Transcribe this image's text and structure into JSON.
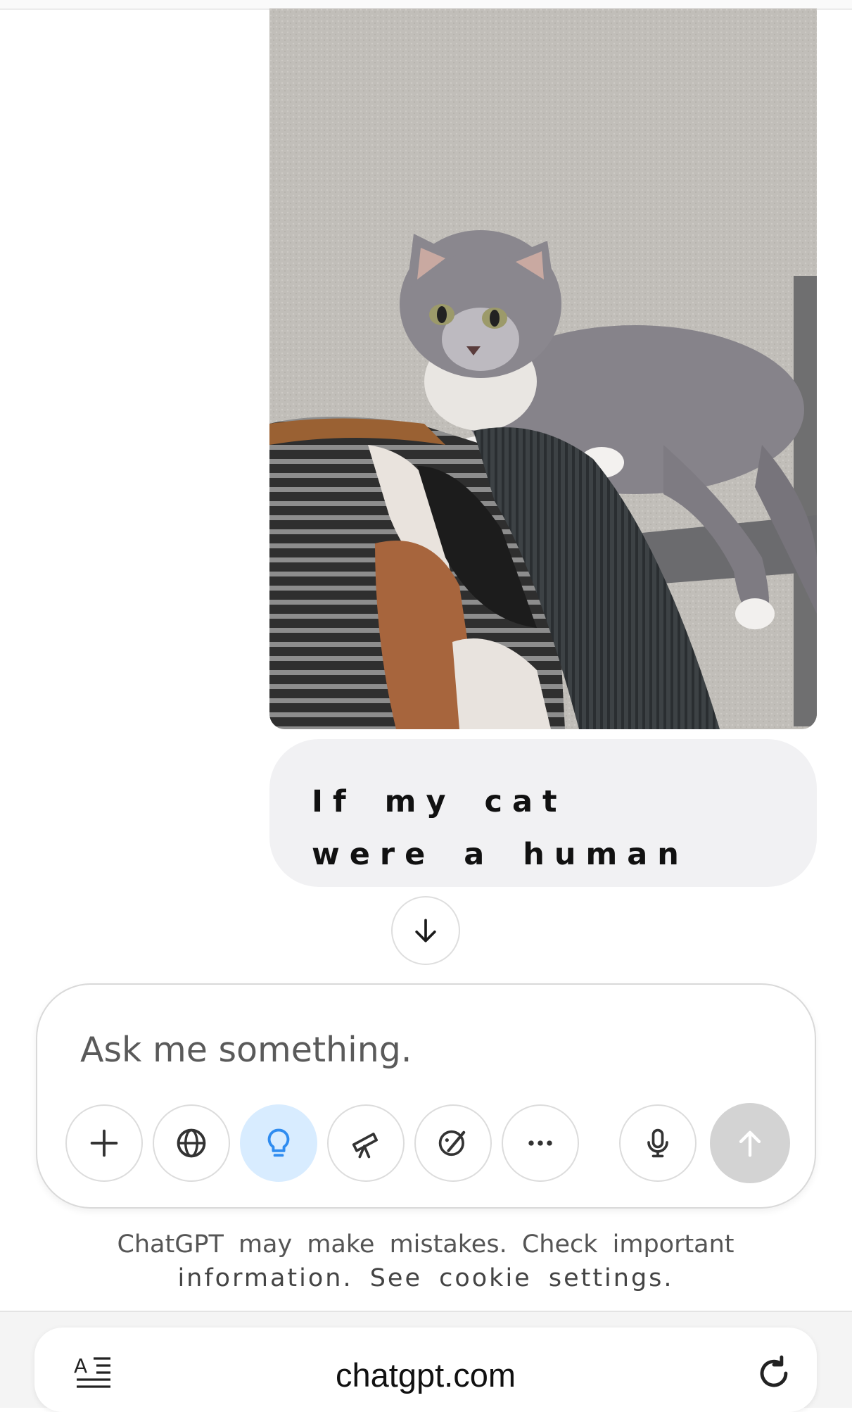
{
  "conversation": {
    "user_image_alt": "cat photo",
    "user_message": "If my cat were a human"
  },
  "composer": {
    "placeholder": "Ask me something.",
    "tools": [
      {
        "name": "plus-icon"
      },
      {
        "name": "globe-icon"
      },
      {
        "name": "lightbulb-icon",
        "active": true
      },
      {
        "name": "telescope-icon"
      },
      {
        "name": "paintbrush-icon"
      },
      {
        "name": "more-icon"
      },
      {
        "name": "microphone-icon"
      },
      {
        "name": "send-arrow-icon"
      }
    ]
  },
  "disclaimer": {
    "line1": "ChatGPT may make mistakes. Check important",
    "line2": "information. See cookie settings."
  },
  "browser": {
    "url": "chatgpt.com"
  },
  "colors": {
    "active_tool_bg": "#d8ecff",
    "active_tool_icon": "#2f8cf0",
    "send_disabled": "#d3d3d3",
    "bubble_bg": "#f1f1f3"
  }
}
